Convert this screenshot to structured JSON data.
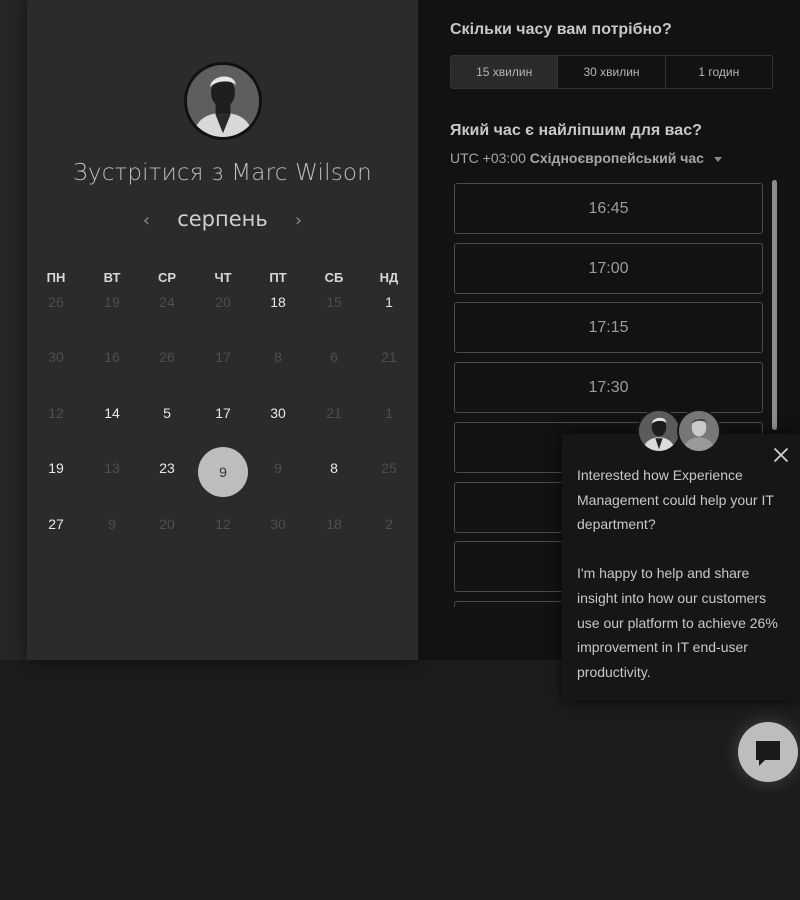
{
  "host": {
    "meet_title": "Зустрітися з Marc Wilson"
  },
  "calendar": {
    "month": "серпень",
    "weekdays": [
      "ПН",
      "ВТ",
      "СР",
      "ЧТ",
      "ПТ",
      "СБ",
      "НД"
    ],
    "weeks": [
      [
        {
          "d": "26",
          "s": "inactive"
        },
        {
          "d": "19",
          "s": "inactive"
        },
        {
          "d": "24",
          "s": "inactive"
        },
        {
          "d": "20",
          "s": "inactive"
        },
        {
          "d": "18",
          "s": "active"
        },
        {
          "d": "15",
          "s": "inactive"
        },
        {
          "d": "1",
          "s": "active"
        }
      ],
      [
        {
          "d": "30",
          "s": "inactive"
        },
        {
          "d": "16",
          "s": "inactive"
        },
        {
          "d": "26",
          "s": "inactive"
        },
        {
          "d": "17",
          "s": "inactive"
        },
        {
          "d": "8",
          "s": "inactive"
        },
        {
          "d": "6",
          "s": "inactive"
        },
        {
          "d": "21",
          "s": "inactive"
        }
      ],
      [
        {
          "d": "12",
          "s": "inactive"
        },
        {
          "d": "14",
          "s": "active"
        },
        {
          "d": "5",
          "s": "active"
        },
        {
          "d": "17",
          "s": "active"
        },
        {
          "d": "30",
          "s": "active"
        },
        {
          "d": "21",
          "s": "inactive"
        },
        {
          "d": "1",
          "s": "inactive"
        }
      ],
      [
        {
          "d": "19",
          "s": "active"
        },
        {
          "d": "13",
          "s": "inactive"
        },
        {
          "d": "23",
          "s": "active"
        },
        {
          "d": "9",
          "s": "selected"
        },
        {
          "d": "9",
          "s": "inactive"
        },
        {
          "d": "8",
          "s": "active"
        },
        {
          "d": "25",
          "s": "inactive"
        }
      ],
      [
        {
          "d": "27",
          "s": "active"
        },
        {
          "d": "9",
          "s": "inactive"
        },
        {
          "d": "20",
          "s": "inactive"
        },
        {
          "d": "12",
          "s": "inactive"
        },
        {
          "d": "30",
          "s": "inactive"
        },
        {
          "d": "18",
          "s": "inactive"
        },
        {
          "d": "2",
          "s": "inactive"
        }
      ]
    ]
  },
  "duration": {
    "heading": "Скільки часу вам потрібно?",
    "options": [
      "15 хвилин",
      "30 хвилин",
      "1 годин"
    ],
    "selected": "15 хвилин"
  },
  "time": {
    "heading": "Який час є найліпшим для вас?",
    "tz_offset": "UTC +03:00",
    "tz_name": "Східноєвропейський час",
    "slots": [
      "16:45",
      "17:00",
      "17:15",
      "17:30",
      "",
      "",
      "",
      ""
    ]
  },
  "chat": {
    "message_1": "Interested how Experience Management could help your IT department?",
    "message_2": "I'm happy to help and share insight into how our customers use our platform to achieve 26% improvement in IT end-user productivity."
  },
  "colors": {
    "accent_selected_day": "#bdbdbd",
    "panel_left": "#2b2b2b",
    "panel_right": "#121212"
  },
  "icons": {
    "prev": "chevron-left-icon",
    "next": "chevron-right-icon",
    "timezone_dropdown": "caret-down-icon",
    "close": "close-icon",
    "chat_launcher": "chat-bubble-icon"
  }
}
